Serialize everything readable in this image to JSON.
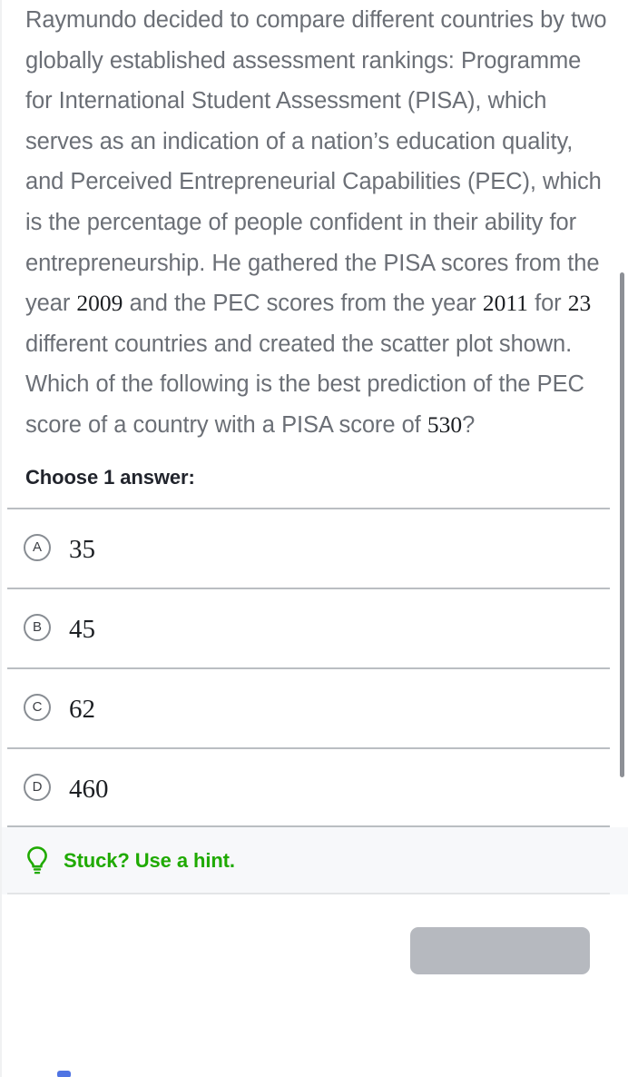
{
  "question": {
    "text_segments": [
      {
        "t": "Raymundo decided to compare different countries by two globally established assessment rankings: Programme for International Student Assessment (PISA), which serves as an indication of a nation’s education quality, and Perceived Entrepreneurial Capabilities (PEC), which is the percentage of people confident in their ability for entrepreneurship. He gathered the PISA scores from the year ",
        "math": false
      },
      {
        "t": "2009",
        "math": true
      },
      {
        "t": " and the PEC scores from the year ",
        "math": false
      },
      {
        "t": "2011",
        "math": true
      },
      {
        "t": " for ",
        "math": false
      },
      {
        "t": "23",
        "math": true
      },
      {
        "t": " different countries and created the scatter plot shown. Which of the following is the best prediction of the PEC score of a country with a PISA score of ",
        "math": false
      },
      {
        "t": "530",
        "math": true
      },
      {
        "t": "?",
        "math": false
      }
    ],
    "full_text": "Raymundo decided to compare different countries by two globally established assessment rankings: Programme for International Student Assessment (PISA), which serves as an indication of a nation’s education quality, and Perceived Entrepreneurial Capabilities (PEC), which is the percentage of people confident in their ability for entrepreneurship. He gathered the PISA scores from the year 2009 and the PEC scores from the year 2011 for 23 different countries and created the scatter plot shown. Which of the following is the best prediction of the PEC score of a country with a PISA score of 530?"
  },
  "choose_header": "Choose 1 answer:",
  "answers": [
    {
      "letter": "A",
      "value": "35"
    },
    {
      "letter": "B",
      "value": "45"
    },
    {
      "letter": "C",
      "value": "62"
    },
    {
      "letter": "D",
      "value": "460"
    }
  ],
  "hint": {
    "label": "Stuck? Use a hint.",
    "icon": "lightbulb-icon",
    "color": "#1faa00"
  },
  "footer": {
    "check_button_label": "",
    "check_button_color": "#b6b9bf"
  },
  "colors": {
    "body_text": "#6b6f76",
    "math_text": "#1c1f23",
    "heading": "#21242c",
    "divider": "#babec2",
    "hint_bg": "#f7f8fa",
    "hint_green": "#1faa00",
    "scrollbar": "#8d9096"
  }
}
